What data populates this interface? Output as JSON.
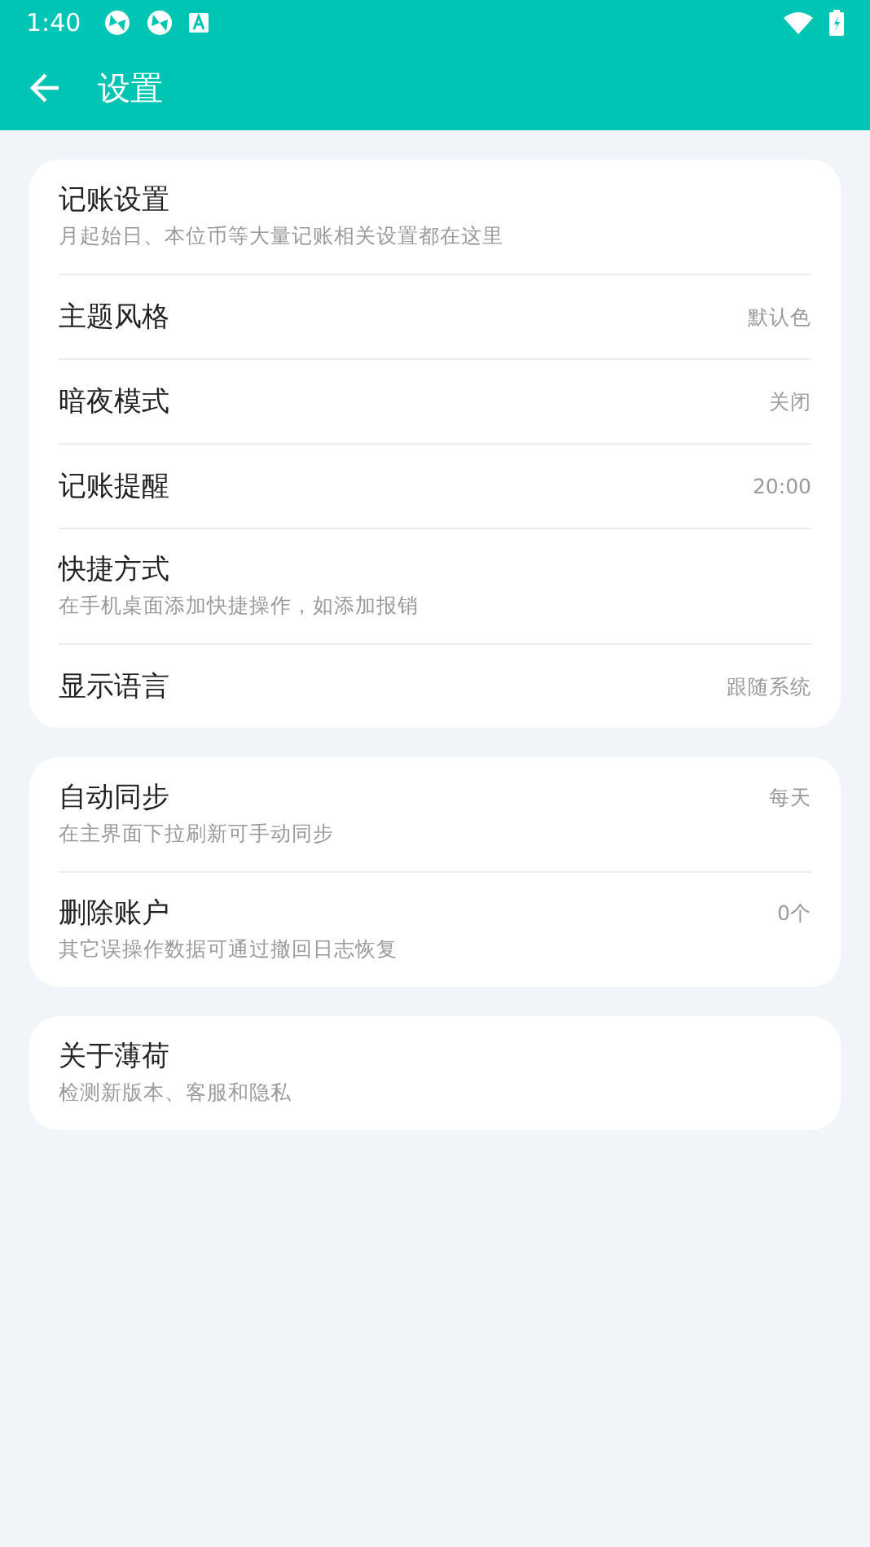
{
  "status_bar": {
    "time": "1:40"
  },
  "app_bar": {
    "title": "设置"
  },
  "groups": [
    {
      "items": [
        {
          "title": "记账设置",
          "subtitle": "月起始日、本位币等大量记账相关设置都在这里"
        },
        {
          "title": "主题风格",
          "value": "默认色"
        },
        {
          "title": "暗夜模式",
          "value": "关闭"
        },
        {
          "title": "记账提醒",
          "value": "20:00"
        },
        {
          "title": "快捷方式",
          "subtitle": "在手机桌面添加快捷操作，如添加报销"
        },
        {
          "title": "显示语言",
          "value": "跟随系统"
        }
      ]
    },
    {
      "items": [
        {
          "title": "自动同步",
          "subtitle": "在主界面下拉刷新可手动同步",
          "value": "每天"
        },
        {
          "title": "删除账户",
          "subtitle": "其它误操作数据可通过撤回日志恢复",
          "value": "0个"
        }
      ]
    },
    {
      "items": [
        {
          "title": "关于薄荷",
          "subtitle": "检测新版本、客服和隐私"
        }
      ]
    }
  ]
}
